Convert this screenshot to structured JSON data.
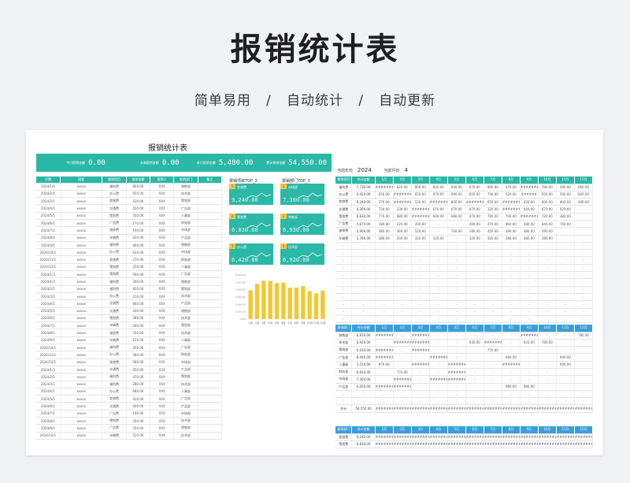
{
  "hero": {
    "title": "报销统计表",
    "subtitle": "简单易用   /   自动统计   /   自动更新"
  },
  "sheet": {
    "title": "报销统计表",
    "kpis": [
      {
        "label": "今日报销金额",
        "value": "0.00"
      },
      {
        "label": "本周报销金额",
        "value": "0.00"
      },
      {
        "label": "本月报销金额",
        "value": "5,480.00"
      },
      {
        "label": "累计报销金额",
        "value": "54,550.00"
      }
    ],
    "left_table": {
      "headers": [
        "日期",
        "摘要",
        "报销项目",
        "报销金额",
        "报销人",
        "报销部门",
        "备注"
      ],
      "rows": [
        [
          "2024/1/4",
          "xxxxx",
          "福利费",
          "800.00",
          "XXX",
          "销售部",
          ""
        ],
        [
          "2024/2/1",
          "xxxxx",
          "办公费",
          "650.00",
          "XXX",
          "技术部",
          ""
        ],
        [
          "2024/2/1",
          "xxxxx",
          "差旅费",
          "520.00",
          "XXX",
          "策划部",
          ""
        ],
        [
          "2024/4/1",
          "xxxxx",
          "交通费",
          "450.00",
          "XXX",
          "广告部",
          ""
        ],
        [
          "2024/5/1",
          "xxxxx",
          "策划费",
          "350.00",
          "XXX",
          "人事部",
          ""
        ],
        [
          "2024/6/1",
          "xxxxx",
          "广告费",
          "270.00",
          "XXX",
          "财务部",
          ""
        ],
        [
          "2024/7/1",
          "xxxxx",
          "维修费",
          "190.00",
          "XXX",
          "市场部",
          ""
        ],
        [
          "2024/8/1",
          "xxxxx",
          "车辆费",
          "420.00",
          "XXX",
          "产品部",
          ""
        ],
        [
          "2024/9/1",
          "xxxxx",
          "福利费",
          "460.00",
          "XXX",
          "销售部",
          ""
        ],
        [
          "2024/10/1",
          "xxxxx",
          "办公费",
          "620.00",
          "XXX",
          "市场部",
          ""
        ],
        [
          "2024/11/1",
          "xxxxx",
          "差旅费",
          "270.00",
          "XXX",
          "财务部",
          ""
        ],
        [
          "2024/12/1",
          "xxxxx",
          "策划费",
          "250.00",
          "XXX",
          "人事部",
          ""
        ],
        [
          "2024/1/3",
          "xxxxx",
          "策划费",
          "590.00",
          "XXX",
          "广告部",
          ""
        ],
        [
          "2024/1/3",
          "xxxxx",
          "福利费",
          "300.00",
          "XXX",
          "销售部",
          ""
        ],
        [
          "2024/2/1",
          "xxxxx",
          "福利费",
          "820.00",
          "XXX",
          "策划部",
          ""
        ],
        [
          "2024/3/1",
          "xxxxx",
          "办公费",
          "410.00",
          "XXX",
          "技术部",
          ""
        ],
        [
          "2024/4/1",
          "xxxxx",
          "交通费",
          "660.00",
          "XXX",
          "产品部",
          ""
        ],
        [
          "2024/5/1",
          "xxxxx",
          "交通费",
          "430.00",
          "XXX",
          "销售部",
          ""
        ],
        [
          "2024/6/1",
          "xxxxx",
          "策划费",
          "380.00",
          "XXX",
          "技术部",
          ""
        ],
        [
          "2024/7/1",
          "xxxxx",
          "车辆费",
          "560.00",
          "XXX",
          "策划部",
          ""
        ],
        [
          "2024/8/1",
          "xxxxx",
          "维修费",
          "350.00",
          "XXX",
          "技术部",
          ""
        ],
        [
          "2024/9/1",
          "xxxxx",
          "车辆费",
          "120.00",
          "XXX",
          "人事部",
          ""
        ],
        [
          "2024/10/1",
          "xxxxx",
          "福利费",
          "450.00",
          "XXX",
          "广告部",
          ""
        ],
        [
          "2024/11/1",
          "xxxxx",
          "办公费",
          "360.00",
          "XXX",
          "财务部",
          ""
        ],
        [
          "2024/12/1",
          "xxxxx",
          "差旅费",
          "580.00",
          "XXX",
          "市场部",
          ""
        ],
        [
          "2024/1/3",
          "xxxxx",
          "交通费",
          "450.00",
          "XXX",
          "产品部",
          ""
        ],
        [
          "2024/2/1",
          "xxxxx",
          "福利费",
          "470.00",
          "XXX",
          "策划部",
          ""
        ],
        [
          "2024/3/1",
          "xxxxx",
          "福利费",
          "280.00",
          "XXX",
          "技术部",
          ""
        ],
        [
          "2024/4/1",
          "xxxxx",
          "办公费",
          "680.00",
          "XXX",
          "人事部",
          ""
        ],
        [
          "2024/5/1",
          "xxxxx",
          "差旅费",
          "430.00",
          "XXX",
          "广告部",
          ""
        ],
        [
          "2024/6/1",
          "xxxxx",
          "交通费",
          "500.00",
          "XXX",
          "产品部",
          ""
        ],
        [
          "2024/7/1",
          "xxxxx",
          "广告费",
          "190.00",
          "XXX",
          "市场部",
          ""
        ],
        [
          "2024/8/1",
          "xxxxx",
          "策划费",
          "350.00",
          "XXX",
          "技术部",
          ""
        ],
        [
          "2024/9/1",
          "xxxxx",
          "广告费",
          "350.00",
          "XXX",
          "销售部",
          ""
        ],
        [
          "2024/10/1",
          "xxxxx",
          "车辆费",
          "520.00",
          "XXX",
          "技术部",
          ""
        ]
      ]
    },
    "cards": {
      "left_title": "报销项目TOP_3",
      "right_title": "报销部门TOP_3",
      "left": [
        {
          "rank": "1",
          "name": "差旅费",
          "value": "9,240.00"
        },
        {
          "rank": "2",
          "name": "策划费",
          "value": "6,830.00"
        },
        {
          "rank": "3",
          "name": "办公费",
          "value": "6,420.00"
        }
      ],
      "right": [
        {
          "rank": "1",
          "name": "市场部",
          "value": "7,360.00"
        },
        {
          "rank": "2",
          "name": "销售部",
          "value": "6,930.00"
        },
        {
          "rank": "3",
          "name": "技术部",
          "value": "6,920.00"
        }
      ]
    },
    "meta": {
      "year_label": "当前年份",
      "year": "2024",
      "month_label": "当前月份",
      "month": "4"
    },
    "table1": {
      "headers": [
        "报销项目",
        "合计金额",
        "1月",
        "2月",
        "3月",
        "4月",
        "5月",
        "6月",
        "7月",
        "8月",
        "9月",
        "10月",
        "11月",
        "12月"
      ],
      "rows": [
        [
          "福利费",
          "7,730.00",
          "########",
          "820.00",
          "800.00",
          "820.00",
          "640.00",
          "670.00",
          "800.00",
          "470.00",
          "##########",
          "780.00",
          "290.00",
          "660.00"
        ],
        [
          "办公费",
          "6,420.00",
          "650.00",
          "########",
          "650.00",
          "970.00",
          "690.00",
          "650.00",
          "730.00",
          "520.00",
          "######",
          "650.00",
          "560.00",
          "820.00"
        ],
        [
          "差旅费",
          "9,240.00",
          "270.00",
          "########",
          "520.00",
          "########",
          "800.00",
          "##########",
          "650.00",
          "##########",
          "420.00",
          "800.00",
          "800.00",
          "490.00"
        ],
        [
          "交通费",
          "6,260.00",
          "720.00",
          "230.00",
          "########",
          "670.00",
          "670.00",
          "870.00",
          "320.00",
          "########",
          "640.00",
          "870.00",
          "620.00",
          ""
        ],
        [
          "策划费",
          "6,830.00",
          "770.00",
          "880.00",
          "########",
          "600.00",
          "680.00",
          "670.00",
          "700.00",
          "790.00",
          "########",
          "720.00",
          "380.00",
          ""
        ],
        [
          "广告费",
          "5,670.00",
          "180.00",
          "220.00",
          "200.00",
          "-",
          "-",
          "200.00",
          "470.00",
          "960.00",
          "580.00",
          "840.00",
          "740.00",
          ""
        ],
        [
          "维修费",
          "3,900.00",
          "380.00",
          "360.00",
          "520.00",
          "-",
          "740.00",
          "180.00",
          "450.00",
          "390.00",
          "380.00",
          "290.00",
          ""
        ],
        [
          "车辆费",
          "3,790.00",
          "380.00",
          "200.00",
          "320.00",
          "320.00",
          "-",
          "320.00",
          "420.00",
          "280.00",
          "480.00",
          "280.00",
          ""
        ],
        [
          "-",
          "-",
          "-",
          "-",
          "-",
          "-",
          "-",
          "-",
          "-",
          "-",
          "-",
          "-",
          "-",
          "-"
        ],
        [
          "-",
          "-",
          "-",
          "-",
          "-",
          "-",
          "-",
          "-",
          "-",
          "-",
          "-",
          "-",
          "-",
          "-"
        ],
        [
          "-",
          "-",
          "-",
          "-",
          "-",
          "-",
          "-",
          "-",
          "-",
          "-",
          "-",
          "-",
          "-",
          "-"
        ],
        [
          "-",
          "-",
          "-",
          "-",
          "-",
          "-",
          "-",
          "-",
          "-",
          "-",
          "-",
          "-",
          "-",
          "-"
        ],
        [
          "-",
          "-",
          "-",
          "-",
          "-",
          "-",
          "-",
          "-",
          "-",
          "-",
          "-",
          "-",
          "-",
          "-"
        ],
        [
          "-",
          "-",
          "-",
          "-",
          "-",
          "-",
          "-",
          "-",
          "-",
          "-",
          "-",
          "-",
          "-",
          "-"
        ],
        [
          "-",
          "-",
          "-",
          "-",
          "-",
          "-",
          "-",
          "-",
          "-",
          "-",
          "-",
          "-",
          "-",
          "-"
        ],
        [
          "-",
          "-",
          "-",
          "-",
          "-",
          "-",
          "-",
          "-",
          "-",
          "-",
          "-",
          "-",
          "-",
          "-"
        ],
        [
          "-",
          "-",
          "-",
          "-",
          "-",
          "-",
          "-",
          "-",
          "-",
          "-",
          "-",
          "-",
          "-",
          "-"
        ],
        [
          "-",
          "-",
          "-",
          "-",
          "-",
          "-",
          "-",
          "-",
          "-",
          "-",
          "-",
          "-",
          "-",
          "-"
        ],
        [
          "-",
          "-",
          "-",
          "-",
          "-",
          "-",
          "-",
          "-",
          "-",
          "-",
          "-",
          "-",
          "-",
          "-"
        ]
      ]
    },
    "table2": {
      "headers": [
        "报销部门",
        "合计金额",
        "1月",
        "2月",
        "3月",
        "4月",
        "5月",
        "6月",
        "7月",
        "8月",
        "9月",
        "10月",
        "11月",
        "12月"
      ],
      "rows": [
        [
          "销售部",
          "6,930.00",
          "########",
          "-",
          "########",
          "-",
          "-",
          "-",
          "-",
          "-",
          "##########",
          "-",
          "-",
          "780.00"
        ],
        [
          "技术部",
          "6,920.00",
          "-",
          "########",
          "########",
          "-",
          "-",
          "930.00",
          "########",
          "-",
          "920.00",
          "780.00",
          ""
        ],
        [
          "策划部",
          "6,030.00",
          "########",
          "-",
          "########",
          "-",
          "-",
          "-",
          "770.00",
          "-",
          "-",
          "-",
          "-",
          ""
        ],
        [
          "广告部",
          "6,040.00",
          "########",
          "-",
          "-",
          "########",
          "-",
          "-",
          "-",
          "940.00",
          "-",
          "-",
          "940.00",
          ""
        ],
        [
          "人事部",
          "5,510.00",
          "870.00",
          "-",
          "########",
          "-",
          "########",
          "-",
          "-",
          "########",
          "-",
          "-",
          "940.00",
          ""
        ],
        [
          "财务部",
          "6,910.00",
          "-",
          "770.00",
          "-",
          "-",
          "##########",
          "-",
          "-",
          "-",
          "-",
          "-",
          ""
        ],
        [
          "市场部",
          "7,360.00",
          "-",
          "########",
          "-",
          "########",
          "##########",
          "-",
          "-",
          "-",
          "-",
          "-",
          ""
        ],
        [
          "产品部",
          "6,020.00",
          "########",
          "########",
          "-",
          "-",
          "-",
          "-",
          "-",
          "980.00",
          "880.00",
          "-",
          "-",
          ""
        ],
        [
          "-",
          "-",
          "-",
          "-",
          "-",
          "-",
          "-",
          "-",
          "-",
          "-",
          "-",
          "-",
          "-",
          "-"
        ],
        [
          "-",
          "-",
          "-",
          "-",
          "-",
          "-",
          "-",
          "-",
          "-",
          "-",
          "-",
          "-",
          "-",
          "-"
        ],
        [
          "合计",
          "54,550.00",
          "########",
          "########",
          "########",
          "########",
          "########",
          "########",
          "########",
          "########",
          "########",
          "########",
          "########",
          "########"
        ]
      ]
    },
    "table3": {
      "headers": [
        "报销部门",
        "合计金额",
        "1月",
        "2月",
        "3月",
        "4月",
        "5月",
        "6月",
        "7月",
        "8月",
        "9月",
        "10月",
        "11月",
        "12月"
      ],
      "rows": [
        [
          "差旅费",
          "9,240.00",
          "########",
          "########",
          "########",
          "########",
          "########",
          "########",
          "########",
          "########",
          "########",
          "########",
          "########",
          "########"
        ],
        [
          "策划费",
          "6,830.00",
          "########",
          "########",
          "########",
          "########",
          "########",
          "########",
          "########",
          "########",
          "########",
          "########",
          "########",
          "########"
        ]
      ]
    }
  },
  "chart_data": {
    "type": "bar",
    "categories": [
      "1月",
      "2月",
      "3月",
      "4月",
      "5月",
      "6月",
      "7月",
      "8月",
      "9月",
      "10月",
      "11月",
      "12月"
    ],
    "values": [
      3900,
      4800,
      5200,
      5200,
      4900,
      4950,
      4300,
      4300,
      4500,
      3800,
      3500,
      3900
    ],
    "ylim": [
      0,
      6000
    ],
    "yticks": [
      "6,000.00",
      "5,000.00",
      "4,000.00",
      "3,000.00",
      "2,000.00",
      "1,000.00",
      "0.00"
    ],
    "colors": {
      "bar": "#f3c830"
    }
  },
  "colors": {
    "teal": "#2bb8a6",
    "blue": "#3a9ed9",
    "yellow": "#f5c542"
  }
}
